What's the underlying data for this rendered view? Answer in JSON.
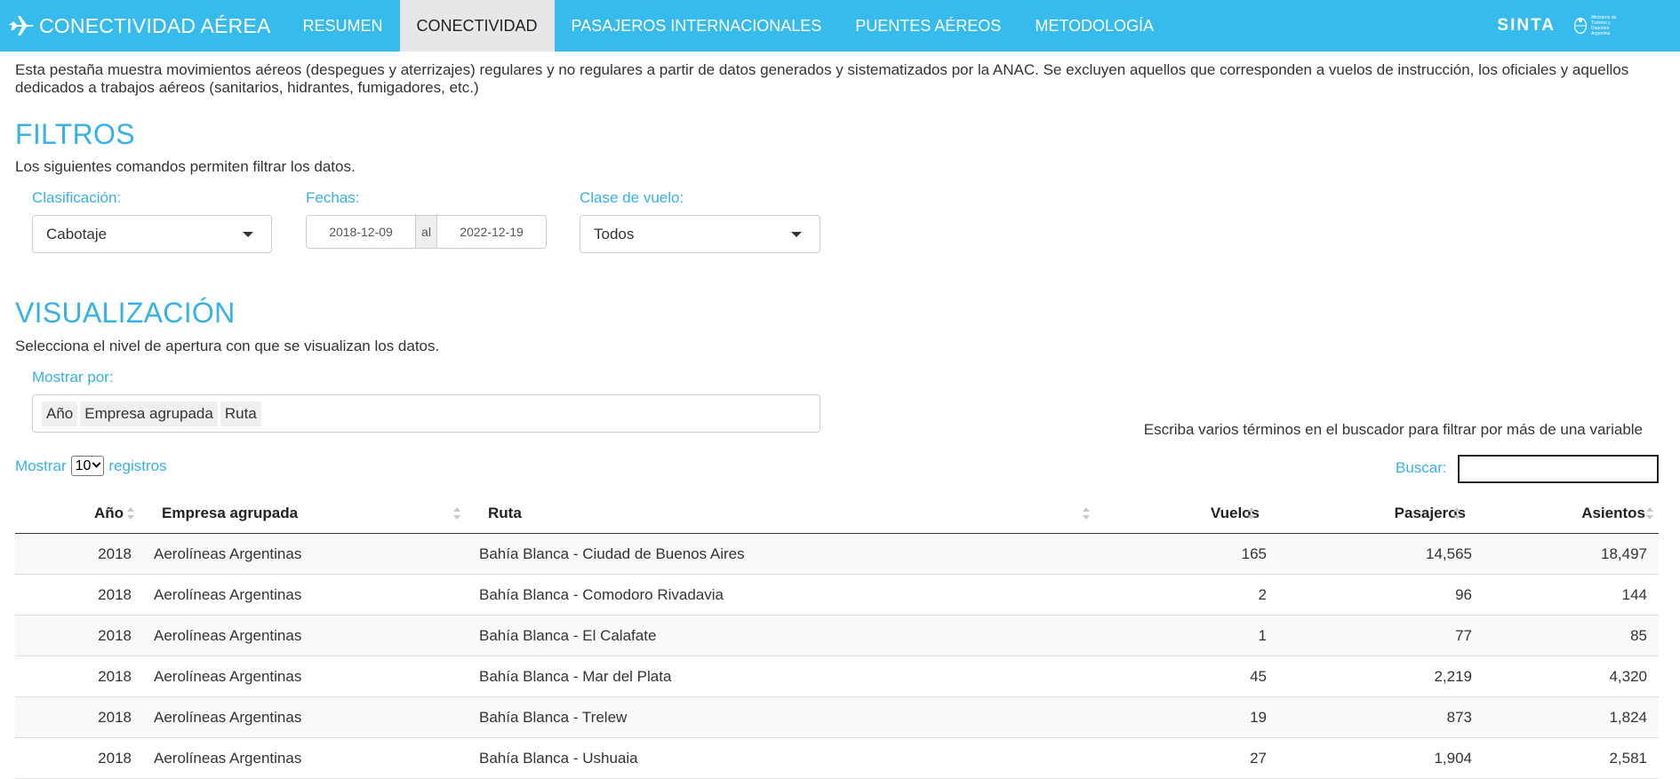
{
  "nav": {
    "brand": "CONECTIVIDAD AÉREA",
    "tabs": [
      {
        "label": "RESUMEN",
        "active": false
      },
      {
        "label": "CONECTIVIDAD",
        "active": true
      },
      {
        "label": "PASAJEROS INTERNACIONALES",
        "active": false
      },
      {
        "label": "PUENTES AÉREOS",
        "active": false
      },
      {
        "label": "METODOLOGÍA",
        "active": false
      }
    ],
    "sinta": "SINTA",
    "ministry": "Ministerio de Turismo y Deportes Argentina"
  },
  "description": "Esta pestaña muestra movimientos aéreos (despegues y aterrizajes) regulares y no regulares a partir de datos generados y sistematizados por la ANAC. Se excluyen aquellos que corresponden a vuelos de instrucción, los oficiales y aquellos dedicados a trabajos aéreos (sanitarios, hidrantes, fumigadores, etc.)",
  "filters": {
    "title": "FILTROS",
    "subtitle": "Los siguientes comandos permiten filtrar los datos.",
    "clasificacion_label": "Clasificación:",
    "clasificacion_value": "Cabotaje",
    "fechas_label": "Fechas:",
    "fecha_desde": "2018-12-09",
    "fecha_sep": "al",
    "fecha_hasta": "2022-12-19",
    "clase_label": "Clase de vuelo:",
    "clase_value": "Todos"
  },
  "visualizacion": {
    "title": "VISUALIZACIÓN",
    "subtitle": "Selecciona el nivel de apertura con que se visualizan los datos.",
    "mostrar_por_label": "Mostrar por:",
    "tags": [
      "Año",
      "Empresa agrupada",
      "Ruta"
    ]
  },
  "table_controls": {
    "hint": "Escriba varios términos en el buscador para filtrar por más de una variable",
    "show_prefix": "Mostrar",
    "page_length": "10",
    "show_suffix": "registros",
    "search_label": "Buscar:",
    "search_value": ""
  },
  "table": {
    "headers": [
      "Año",
      "Empresa agrupada",
      "Ruta",
      "Vuelos",
      "Pasajeros",
      "Asientos"
    ],
    "rows": [
      [
        "2018",
        "Aerolíneas Argentinas",
        "Bahía Blanca - Ciudad de Buenos Aires",
        "165",
        "14,565",
        "18,497"
      ],
      [
        "2018",
        "Aerolíneas Argentinas",
        "Bahía Blanca - Comodoro Rivadavia",
        "2",
        "96",
        "144"
      ],
      [
        "2018",
        "Aerolíneas Argentinas",
        "Bahía Blanca - El Calafate",
        "1",
        "77",
        "85"
      ],
      [
        "2018",
        "Aerolíneas Argentinas",
        "Bahía Blanca - Mar del Plata",
        "45",
        "2,219",
        "4,320"
      ],
      [
        "2018",
        "Aerolíneas Argentinas",
        "Bahía Blanca - Trelew",
        "19",
        "873",
        "1,824"
      ],
      [
        "2018",
        "Aerolíneas Argentinas",
        "Bahía Blanca - Ushuaia",
        "27",
        "1,904",
        "2,581"
      ]
    ]
  },
  "colors": {
    "navbar": "#37bbed",
    "accent": "#37b1e6",
    "active_tab": "#e7e7e7"
  }
}
